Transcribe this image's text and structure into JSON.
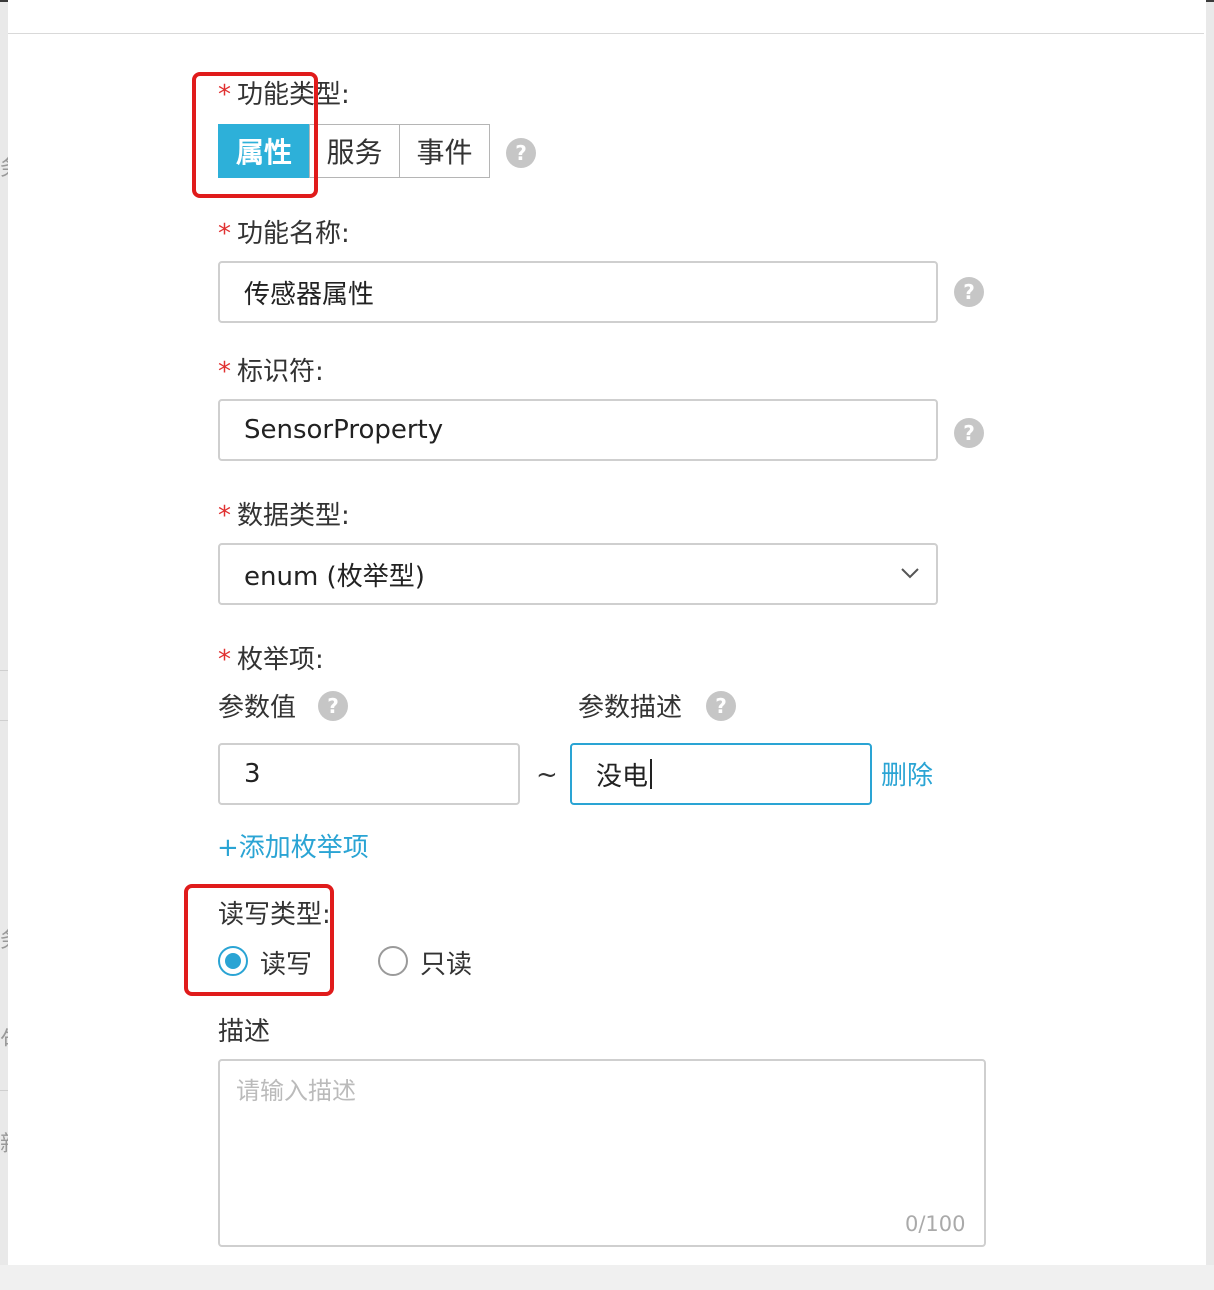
{
  "form": {
    "function_type": {
      "label": "功能类型:",
      "options": [
        "属性",
        "服务",
        "事件"
      ],
      "selected": "属性",
      "help_icon": "?"
    },
    "function_name": {
      "label": "功能名称:",
      "value": "传感器属性",
      "help_icon": "?"
    },
    "identifier": {
      "label": "标识符:",
      "value": "SensorProperty",
      "help_icon": "?"
    },
    "data_type": {
      "label": "数据类型:",
      "value": "enum (枚举型)"
    },
    "enum_items": {
      "label": "枚举项:",
      "param_value_label": "参数值",
      "param_desc_label": "参数描述",
      "help_icon": "?",
      "row": {
        "value": "3",
        "separator": "~",
        "description": "没电",
        "delete_label": "删除"
      },
      "add_label": "+添加枚举项"
    },
    "rw_type": {
      "label": "读写类型:",
      "options": [
        "读写",
        "只读"
      ],
      "selected": "读写"
    },
    "description": {
      "label": "描述",
      "placeholder": "请输入描述",
      "counter": "0/100"
    },
    "required_mark": "*"
  },
  "background": {
    "glyphs": [
      "务",
      "务",
      "句",
      "新"
    ]
  },
  "colors": {
    "accent": "#2db0d9",
    "link": "#2aa4d4",
    "required": "#e03131",
    "annotation": "#e01b1b"
  }
}
